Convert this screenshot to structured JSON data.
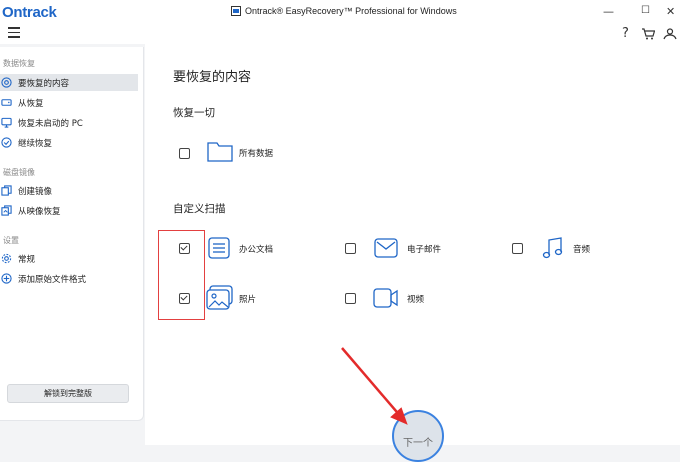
{
  "window": {
    "logo": "Ontrack",
    "title": "Ontrack® EasyRecovery™ Professional for Windows",
    "minimize": "—",
    "maximize": "☐",
    "close": "✕"
  },
  "toolbar": {
    "help": "?",
    "cart": "🛒",
    "account": "⚇"
  },
  "sidebar": {
    "sections": [
      {
        "title": "数据恢复",
        "items": [
          "要恢复的内容",
          "从恢复",
          "恢复未启动的 PC",
          "继续恢复"
        ]
      },
      {
        "title": "磁盘镜像",
        "items": [
          "创建镜像",
          "从映像恢复"
        ]
      },
      {
        "title": "设置",
        "items": [
          "常规",
          "添加原始文件格式"
        ]
      }
    ],
    "unlock_label": "解锁到完整版"
  },
  "main": {
    "title": "要恢复的内容",
    "restore_all": {
      "heading": "恢复一切",
      "option": "所有数据"
    },
    "custom": {
      "heading": "自定义扫描",
      "options": [
        {
          "label": "办公文档",
          "checked": true
        },
        {
          "label": "电子邮件",
          "checked": false
        },
        {
          "label": "音频",
          "checked": false
        },
        {
          "label": "照片",
          "checked": true
        },
        {
          "label": "视频",
          "checked": false
        }
      ]
    },
    "next_label": "下一个"
  },
  "colors": {
    "accent": "#1f66c7",
    "highlight_box": "#e34040",
    "button_ring": "#3b82e0"
  }
}
